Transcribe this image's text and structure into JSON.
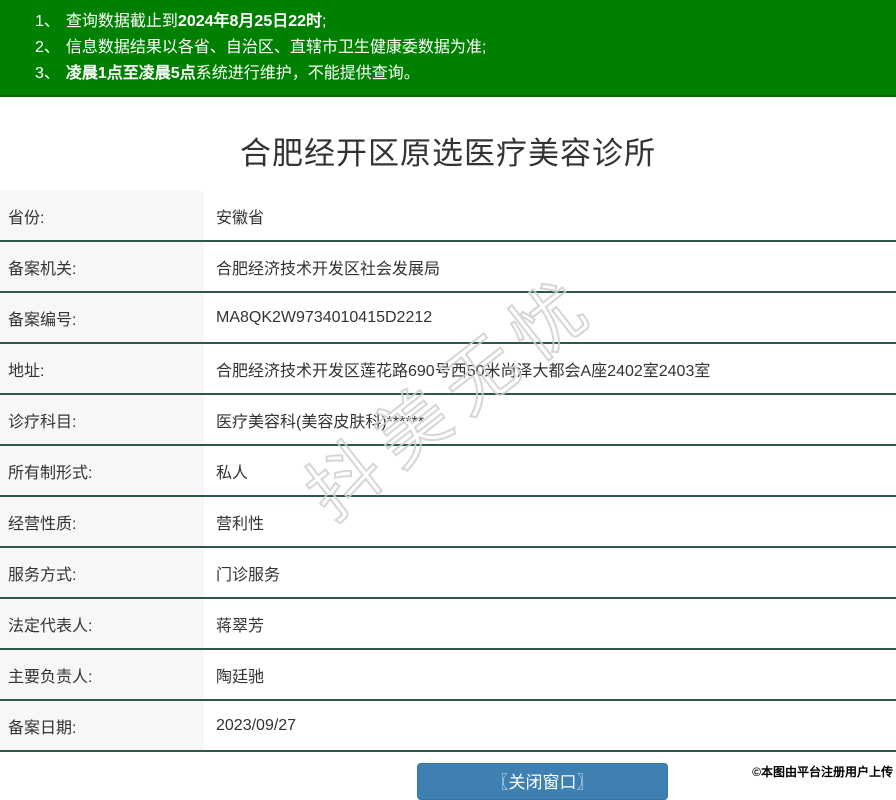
{
  "notice": {
    "bg_color": "#008000",
    "text_color": "#ffffff",
    "items": [
      {
        "num": "1、",
        "pre": "查询数据截止到",
        "bold": "2024年8月25日22时",
        "post": ";"
      },
      {
        "num": "2、",
        "pre": "信息数据结果以各省、自治区、直辖市卫生健康委数据为准;",
        "bold": "",
        "post": ""
      },
      {
        "num": "3、",
        "pre": "",
        "bold": "凌晨1点至凌晨5点",
        "post": "系统进行维护，不能提供查询。"
      }
    ]
  },
  "title": "合肥经开区原选医疗美容诊所",
  "table": {
    "separator_color": "#2d584b",
    "label_bg": "#f7f7f7",
    "rows": [
      {
        "label": "省份:",
        "value": "安徽省"
      },
      {
        "label": "备案机关:",
        "value": "合肥经济技术开发区社会发展局"
      },
      {
        "label": "备案编号:",
        "value": "MA8QK2W9734010415D2212"
      },
      {
        "label": "地址:",
        "value": "合肥经济技术开发区莲花路690号西50米尚泽大都会A座2402室2403室"
      },
      {
        "label": "诊疗科目:",
        "value": "医疗美容科(美容皮肤科)******"
      },
      {
        "label": "所有制形式:",
        "value": "私人"
      },
      {
        "label": "经营性质:",
        "value": "营利性"
      },
      {
        "label": "服务方式:",
        "value": "门诊服务"
      },
      {
        "label": "法定代表人:",
        "value": "蒋翠芳"
      },
      {
        "label": "主要负责人:",
        "value": "陶廷驰"
      },
      {
        "label": "备案日期:",
        "value": "2023/09/27"
      }
    ]
  },
  "footer": {
    "close_button_label": "〖关闭窗口〗",
    "button_color": "#3e80b2"
  },
  "watermark_text": "抖美无忧",
  "copyright": "©本图由平台注册用户上传"
}
